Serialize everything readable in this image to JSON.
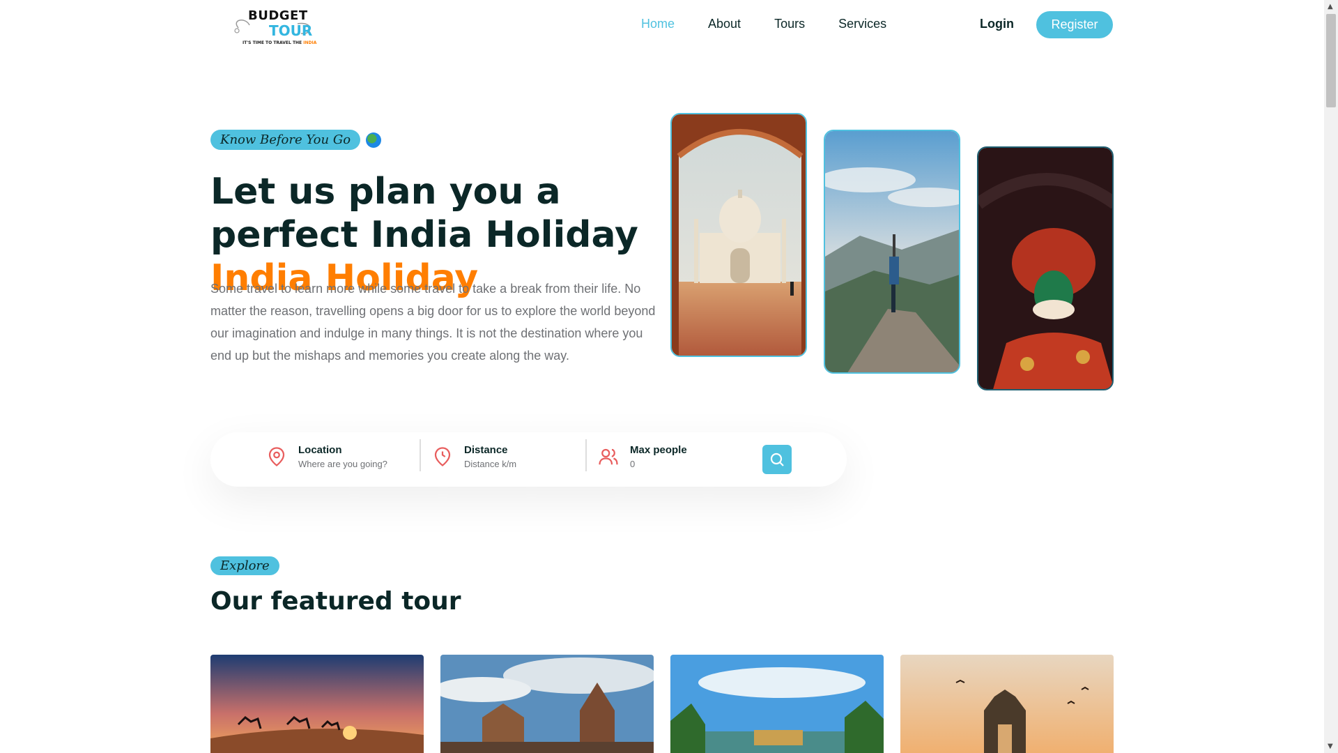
{
  "header": {
    "logo": {
      "line1": "BUDGET",
      "line2": "TOUR",
      "tagline": "IT'S TIME TO TRAVEL THE",
      "tagline_highlight": "INDIA"
    },
    "nav": [
      {
        "label": "Home",
        "active": true
      },
      {
        "label": "About",
        "active": false
      },
      {
        "label": "Tours",
        "active": false
      },
      {
        "label": "Services",
        "active": false
      }
    ],
    "login_label": "Login",
    "register_label": "Register"
  },
  "hero": {
    "subtitle": "Know Before You Go",
    "title_main": "Let us plan you a perfect India Holiday",
    "title_highlight": "India Holiday",
    "description": "Some travel to learn more while some travel to take a break from their life. No matter the reason, travelling opens a big door for us to explore the world beyond our imagination and indulge in many things. It is not the destination where you end up but the mishaps and memories you create along the way.",
    "images": [
      "taj-mahal",
      "yoga-mountain",
      "kathakali-dancer"
    ]
  },
  "search": {
    "location": {
      "label": "Location",
      "placeholder": "Where are you going?"
    },
    "distance": {
      "label": "Distance",
      "placeholder": "Distance k/m"
    },
    "max_people": {
      "label": "Max people",
      "placeholder": "0"
    }
  },
  "featured": {
    "subtitle": "Explore",
    "title": "Our featured tour",
    "cards": [
      "desert-camels",
      "hampi-temple",
      "kerala-backwaters",
      "gateway-of-india"
    ]
  },
  "colors": {
    "accent": "#4fc1df",
    "highlight": "#ff7e01",
    "heading": "#0b2727",
    "text": "#6e7074",
    "icon": "#e85d5d"
  }
}
